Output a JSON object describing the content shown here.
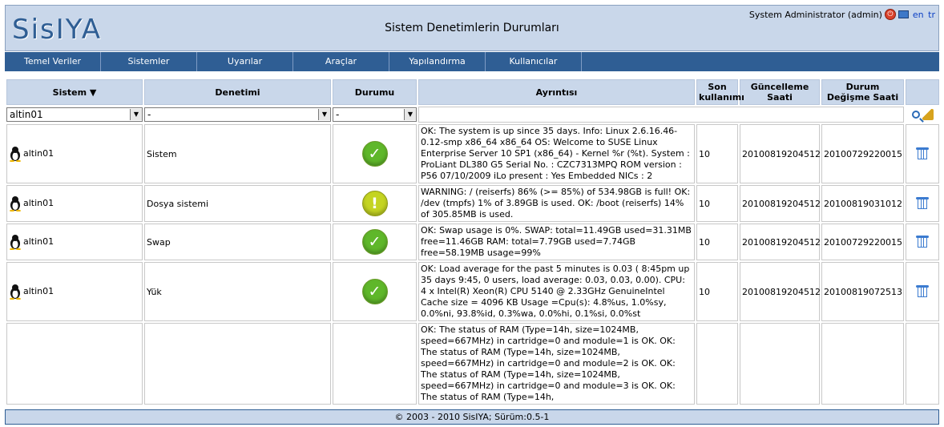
{
  "header": {
    "logo": "SisIYA",
    "title": "Sistem Denetimlerin Durumları",
    "user": "System Administrator (admin)",
    "lang_en": "en",
    "lang_tr": "tr"
  },
  "menu": [
    "Temel Veriler",
    "Sistemler",
    "Uyarılar",
    "Araçlar",
    "Yapılandırma",
    "Kullanıcılar"
  ],
  "table": {
    "columns": [
      "Sistem ▼",
      "Denetimi",
      "Durumu",
      "Ayrıntısı",
      "Son kullanımı",
      "Güncelleme Saati",
      "Durum Değişme Saati"
    ],
    "filters": {
      "system": "altin01",
      "check": "-",
      "status": "-"
    },
    "rows": [
      {
        "system": "altin01",
        "check": "Sistem",
        "status": "ok",
        "detail": "OK: The system is up since 35 days. Info: Linux 2.6.16.46-0.12-smp x86_64 x86_64 OS: Welcome to SUSE Linux Enterprise Server 10 SP1 (x86_64) - Kernel %r (%t). System : ProLiant DL380 G5 Serial No. : CZC7313MPQ ROM version : P56 07/10/2009 iLo present : Yes Embedded NICs : 2",
        "last_use": "10",
        "update_time": "20100819204512",
        "change_time": "20100729220015"
      },
      {
        "system": "altin01",
        "check": "Dosya sistemi",
        "status": "warning",
        "detail": "WARNING: / (reiserfs) 86% (>= 85%) of 534.98GB is full! OK: /dev (tmpfs) 1% of 3.89GB is used. OK: /boot (reiserfs) 14% of 305.85MB is used.",
        "last_use": "10",
        "update_time": "20100819204512",
        "change_time": "20100819031012"
      },
      {
        "system": "altin01",
        "check": "Swap",
        "status": "ok",
        "detail": "OK: Swap usage is 0%. SWAP: total=11.49GB used=31.31MB free=11.46GB RAM: total=7.79GB used=7.74GB free=58.19MB usage=99%",
        "last_use": "10",
        "update_time": "20100819204512",
        "change_time": "20100729220015"
      },
      {
        "system": "altin01",
        "check": "Yük",
        "status": "ok",
        "detail": "OK: Load average for the past 5 minutes is 0.03 ( 8:45pm up 35 days 9:45, 0 users, load average: 0.03, 0.03, 0.00). CPU: 4 x Intel(R) Xeon(R) CPU 5140 @ 2.33GHz GenuineIntel Cache size = 4096 KB Usage =Cpu(s): 4.8%us, 1.0%sy, 0.0%ni, 93.8%id, 0.3%wa, 0.0%hi, 0.1%si, 0.0%st",
        "last_use": "10",
        "update_time": "20100819204512",
        "change_time": "20100819072513"
      },
      {
        "system": "",
        "check": "",
        "status": "",
        "detail": "OK: The status of RAM (Type=14h, size=1024MB, speed=667MHz) in cartridge=0 and module=1 is OK. OK: The status of RAM (Type=14h, size=1024MB, speed=667MHz) in cartridge=0 and module=2 is OK. OK: The status of RAM (Type=14h, size=1024MB, speed=667MHz) in cartridge=0 and module=3 is OK. OK: The status of RAM (Type=14h,",
        "last_use": "",
        "update_time": "",
        "change_time": ""
      }
    ]
  },
  "footer": "© 2003 - 2010 SisIYA; Sürüm:0.5-1"
}
